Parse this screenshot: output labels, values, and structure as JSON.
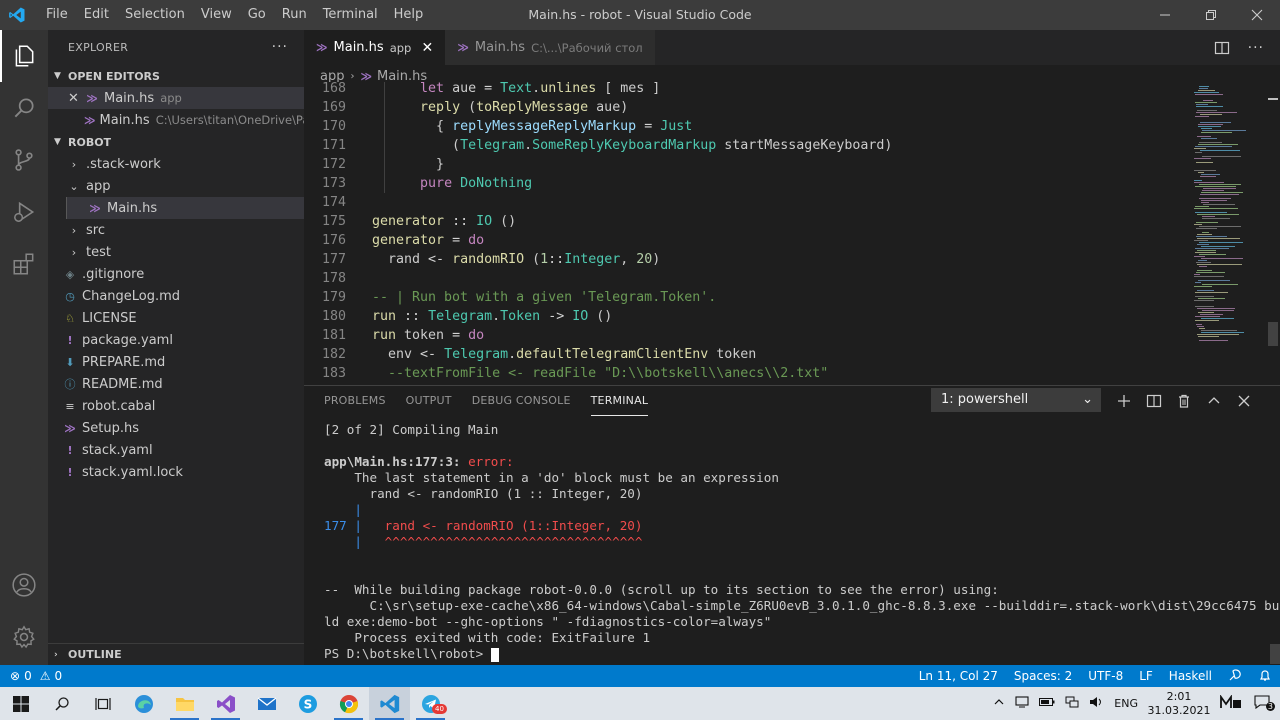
{
  "titlebar": {
    "menu": [
      "File",
      "Edit",
      "Selection",
      "View",
      "Go",
      "Run",
      "Terminal",
      "Help"
    ],
    "title": "Main.hs - robot - Visual Studio Code"
  },
  "sidebar": {
    "title": "EXPLORER",
    "open_editors": {
      "heading": "OPEN EDITORS",
      "items": [
        {
          "name": "Main.hs",
          "desc": "app"
        },
        {
          "name": "Main.hs",
          "desc": "C:\\Users\\titan\\OneDrive\\Pa..."
        }
      ]
    },
    "project": {
      "heading": "ROBOT",
      "items": [
        {
          "name": ".stack-work",
          "kind": "folder"
        },
        {
          "name": "app",
          "kind": "folder-open"
        },
        {
          "name": "Main.hs",
          "kind": "haskell"
        },
        {
          "name": "src",
          "kind": "folder"
        },
        {
          "name": "test",
          "kind": "folder"
        },
        {
          "name": ".gitignore",
          "kind": "git"
        },
        {
          "name": "ChangeLog.md",
          "kind": "info"
        },
        {
          "name": "LICENSE",
          "kind": "license"
        },
        {
          "name": "package.yaml",
          "kind": "yaml"
        },
        {
          "name": "PREPARE.md",
          "kind": "markdown"
        },
        {
          "name": "README.md",
          "kind": "info"
        },
        {
          "name": "robot.cabal",
          "kind": "cabal"
        },
        {
          "name": "Setup.hs",
          "kind": "haskell"
        },
        {
          "name": "stack.yaml",
          "kind": "yaml"
        },
        {
          "name": "stack.yaml.lock",
          "kind": "yaml"
        }
      ]
    },
    "outline": "OUTLINE"
  },
  "tabs": [
    {
      "name": "Main.hs",
      "desc": "app"
    },
    {
      "name": "Main.hs",
      "desc": "C:\\...\\Рабочий стол"
    }
  ],
  "breadcrumb": {
    "folder": "app",
    "file": "Main.hs"
  },
  "code_lines": [
    {
      "n": "168",
      "text": "      let aue = Text.unlines [ mes ]"
    },
    {
      "n": "169",
      "text": "      reply (toReplyMessage aue)"
    },
    {
      "n": "170",
      "text": "        { replyMessageReplyMarkup = Just"
    },
    {
      "n": "171",
      "text": "          (Telegram.SomeReplyKeyboardMarkup startMessageKeyboard)"
    },
    {
      "n": "172",
      "text": "        }"
    },
    {
      "n": "173",
      "text": "      pure DoNothing"
    },
    {
      "n": "174",
      "text": ""
    },
    {
      "n": "175",
      "text": "generator :: IO ()"
    },
    {
      "n": "176",
      "text": "generator = do"
    },
    {
      "n": "177",
      "text": "  rand <- randomRIO (1::Integer, 20)"
    },
    {
      "n": "178",
      "text": ""
    },
    {
      "n": "179",
      "text": "-- | Run bot with a given 'Telegram.Token'."
    },
    {
      "n": "180",
      "text": "run :: Telegram.Token -> IO ()"
    },
    {
      "n": "181",
      "text": "run token = do"
    },
    {
      "n": "182",
      "text": "  env <- Telegram.defaultTelegramClientEnv token"
    },
    {
      "n": "183",
      "text": "  --textFromFile <- readFile \"D:\\\\botskell\\\\anecs\\\\2.txt\""
    }
  ],
  "panel": {
    "tabs": [
      "PROBLEMS",
      "OUTPUT",
      "DEBUG CONSOLE",
      "TERMINAL"
    ],
    "terminal_select": "1: powershell"
  },
  "terminal": {
    "l1": "[2 of 2] Compiling Main",
    "l3a": "app\\Main.hs:177:3: ",
    "l3b": "error:",
    "l4": "    The last statement in a 'do' block must be an expression",
    "l5": "      rand <- randomRIO (1 :: Integer, 20)",
    "l6": "    |",
    "l7a": "177 |",
    "l7b": "   rand <- randomRIO (1::Integer, 20)",
    "l8a": "    |",
    "l8b": "   ^^^^^^^^^^^^^^^^^^^^^^^^^^^^^^^^^^",
    "l11": "--  While building package robot-0.0.0 (scroll up to its section to see the error) using:",
    "l12": "      C:\\sr\\setup-exe-cache\\x86_64-windows\\Cabal-simple_Z6RU0evB_3.0.1.0_ghc-8.8.3.exe --builddir=.stack-work\\dist\\29cc6475 bui",
    "l13": "ld exe:demo-bot --ghc-options \" -fdiagnostics-color=always\"",
    "l14": "    Process exited with code: ExitFailure 1",
    "l15": "PS D:\\botskell\\robot> "
  },
  "statusbar": {
    "errors": "0",
    "warnings": "0",
    "position": "Ln 11, Col 27",
    "spaces": "Spaces: 2",
    "encoding": "UTF-8",
    "eol": "LF",
    "language": "Haskell"
  },
  "taskbar": {
    "lang": "ENG",
    "time": "2:01",
    "date": "31.03.2021",
    "badge": "40",
    "notifications": "3"
  }
}
